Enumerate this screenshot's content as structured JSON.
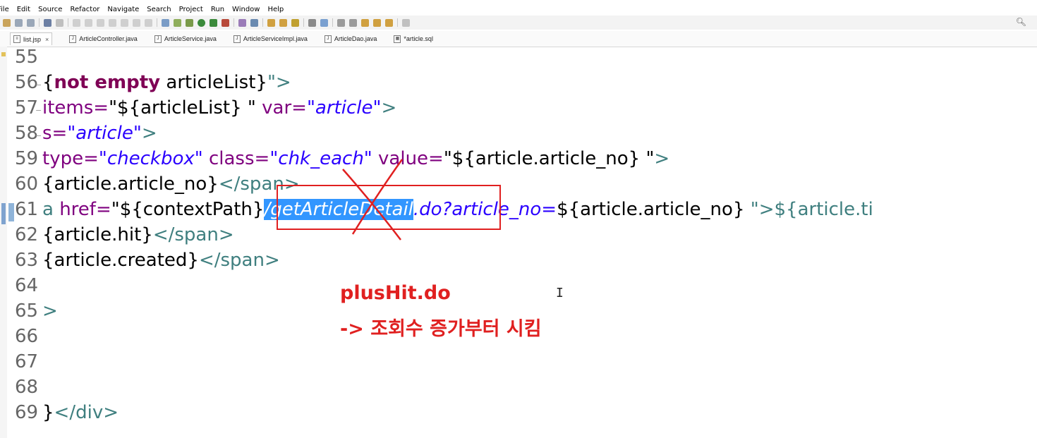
{
  "menu": [
    "File",
    "Edit",
    "Source",
    "Refactor",
    "Navigate",
    "Search",
    "Project",
    "Run",
    "Window",
    "Help"
  ],
  "toolbar": {
    "search_icon": "search-icon"
  },
  "tabs": [
    {
      "label": "list.jsp",
      "active": true,
      "close": "×"
    },
    {
      "label": "ArticleController.java"
    },
    {
      "label": "ArticleService.java"
    },
    {
      "label": "ArticleServiceImpl.java"
    },
    {
      "label": "ArticleDao.java"
    },
    {
      "label": "*article.sql"
    }
  ],
  "lines": [
    {
      "no": "55"
    },
    {
      "no": "56",
      "fold": "−",
      "t1": "{",
      "t2": "not empty",
      "t3": " articleList}",
      "t4": "\">"
    },
    {
      "no": "57",
      "fold": "−",
      "t1": "items=",
      "t2": "\"${articleList} \"",
      "t3": " var=",
      "t4": "\"article\"",
      "t5": ">"
    },
    {
      "no": "58",
      "fold": "−",
      "t1": "s=",
      "t2": "\"article\"",
      "t3": ">"
    },
    {
      "no": "59",
      "t1": "type=",
      "t2": "\"checkbox\"",
      "t3": " class=",
      "t4": "\"chk_each\"",
      "t5": " value=",
      "t6": "\"${article.article_no} \"",
      "t7": ">"
    },
    {
      "no": "60",
      "t1": "{article.article_no}",
      "t2": "</span>"
    },
    {
      "no": "61",
      "t1": "a ",
      "t2": "href=",
      "t3": "\"${contextPath}",
      "t4": "/getArticleDetail",
      "t5": ".do?article_no=",
      "t6": "${article.article_no} ",
      "t7": "\">${article.ti"
    },
    {
      "no": "62",
      "t1": "{article.hit}",
      "t2": "</span>"
    },
    {
      "no": "63",
      "t1": "{article.created}",
      "t2": "</span>"
    },
    {
      "no": "64"
    },
    {
      "no": "65",
      "t1": ">"
    },
    {
      "no": "66"
    },
    {
      "no": "67"
    },
    {
      "no": "68"
    },
    {
      "no": "69",
      "t1": "}",
      "t2": "</div>"
    }
  ],
  "annotation": {
    "line1": "plusHit.do",
    "line2": "-> 조회수 증가부터 시킴",
    "color": "#e02020"
  }
}
